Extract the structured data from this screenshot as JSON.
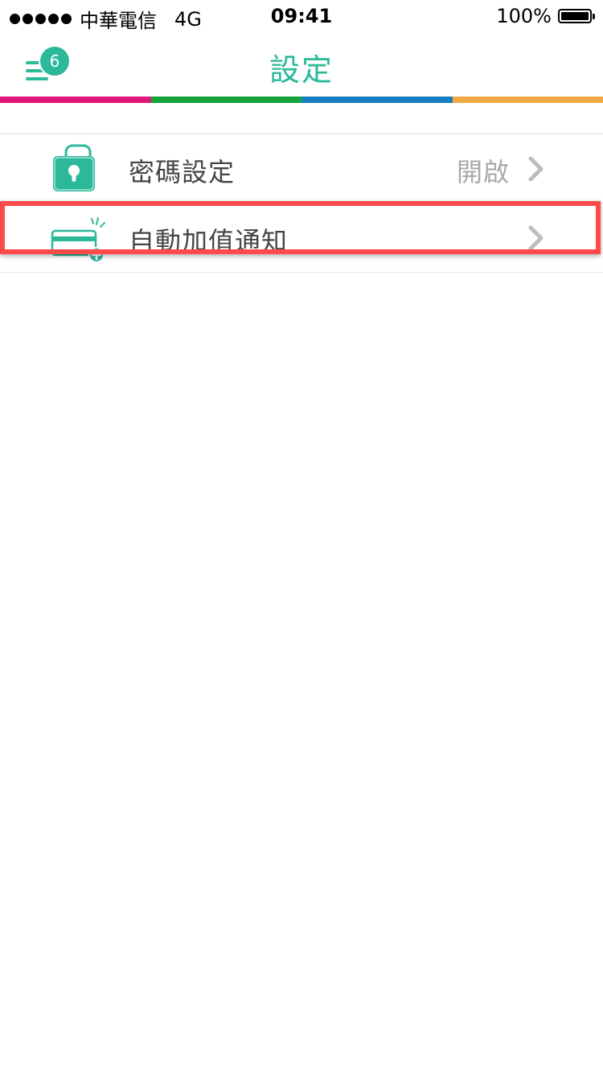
{
  "status_bar": {
    "carrier": "中華電信",
    "network": "4G",
    "time": "09:41",
    "battery": "100%"
  },
  "nav": {
    "title": "設定",
    "badge_count": "6",
    "menu_icon": "hamburger-menu-icon"
  },
  "colors": {
    "accent": "#2bb99a",
    "stripe": [
      "#e0177c",
      "#17a33c",
      "#1a7cc1",
      "#f2aa44"
    ],
    "highlight": "#ff4a4a"
  },
  "settings": {
    "items": [
      {
        "label": "密碼設定",
        "value": "開啟",
        "icon": "lock-icon"
      },
      {
        "label": "自動加值通知",
        "value": "",
        "icon": "card-add-icon"
      }
    ]
  }
}
